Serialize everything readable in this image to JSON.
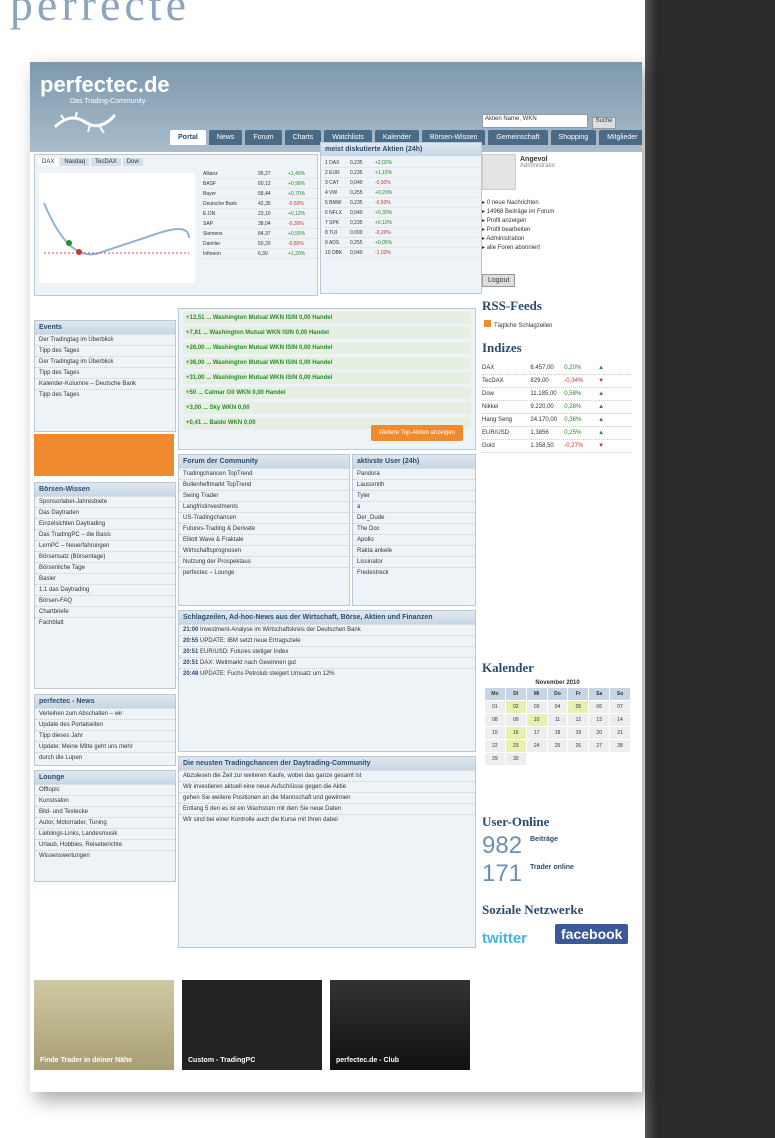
{
  "heading": "e perrecte",
  "brand": {
    "logo": "perfectec.de",
    "tagline": "Das Trading-Community"
  },
  "nav": [
    "Portal",
    "News",
    "Forum",
    "Charts",
    "Watchlists",
    "Kalender",
    "Börsen-Wissen",
    "Gemeinschaft",
    "Shopping",
    "Mitglieder"
  ],
  "search": {
    "value": "Aktien Name, WKN",
    "button": "Suche"
  },
  "chart_tabs": [
    "DAX",
    "Nasdaq",
    "TecDAX",
    "Dow"
  ],
  "market_table": [
    [
      "Allianz",
      "95,27",
      "+1,40%"
    ],
    [
      "BASF",
      "60,12",
      "+0,98%"
    ],
    [
      "Bayer",
      "58,44",
      "+0,70%"
    ],
    [
      "Deutsche Bank",
      "42,35",
      "-0,50%"
    ],
    [
      "E.ON",
      "23,10",
      "+0,12%"
    ],
    [
      "SAP",
      "38,04",
      "-0,30%"
    ],
    [
      "Siemens",
      "84,37",
      "+0,55%"
    ],
    [
      "Daimler",
      "50,20",
      "-0,80%"
    ],
    [
      "Infineon",
      "6,30",
      "+1,20%"
    ]
  ],
  "most_watched_title": "meist diskutierte Aktien (24h)",
  "most_watched": [
    [
      "1 DAX",
      "0,235",
      "+2,02%"
    ],
    [
      "2 EUR",
      "0,235",
      "+1,15%"
    ],
    [
      "3 CAT",
      "0,040",
      "-0,90%"
    ],
    [
      "4 VW",
      "0,255",
      "+0,20%"
    ],
    [
      "5 BMW",
      "0,235",
      "-0,50%"
    ],
    [
      "6 NFLX",
      "0,040",
      "+0,30%"
    ],
    [
      "7 SPK",
      "0,235",
      "+0,10%"
    ],
    [
      "8 TUI",
      "0,000",
      "-0,20%"
    ],
    [
      "9 ADS",
      "0,255",
      "+0,05%"
    ],
    [
      "10 DBK",
      "0,040",
      "-1,02%"
    ]
  ],
  "events_title": "Events",
  "events": [
    "Der Tradingtag im Überblick",
    "Tipp des Tages",
    "Der Tradingtag im Überblick",
    "Tipp des Tages",
    "Kalender-Kolumne – Deutsche Bank",
    "Tipp des Tages"
  ],
  "wissen_title": "Börsen-Wissen",
  "wissen": [
    "Sponsorlabel-Jahresbiete",
    "Das Daytraden",
    "Einzelsichten Daytrading",
    "Das TradingPC – die Basis",
    "LernPC – Neuerfahrungen",
    "Börsensatz (Börsentage)",
    "Börsenliche Tage",
    "Basler",
    "1:1 das Daytrading",
    "Börsen-FAQ",
    "Chartbriefe",
    "Fachblatt"
  ],
  "news_title": "perfectec - News",
  "news": [
    "Verleihen zum Abschalten – wir",
    "Update des Portalseiten",
    "Tipp dieses Jahr",
    "Update: Meine Mitte geht uns mehr",
    "durch die Lupen"
  ],
  "lounge_title": "Lounge",
  "lounge": [
    "Offtopic",
    "Kunstsalon",
    "Bild- und Textecke",
    "Autor, Motorrader, Tuning",
    "Lieblings-Links, Landesmusik",
    "Urlaub, Hobbies, Reiseberichte",
    "Wissenswertungen"
  ],
  "stocks": [
    "+12,51 ... Washington Mutual WKN ISIN 0,00 Handel",
    "+7,81 ... Washington Mutual WKN ISIN 0,00 Handel",
    "+26,00 ... Washington Mutual WKN ISIN 0,00 Handel",
    "+36,00 ... Washington Mutual WKN ISIN 0,00 Handel",
    "+31,00 ... Washington Mutual WKN ISIN 0,00 Handel",
    "+50 ... Calmar Oil WKN 0,00 Handel",
    "+3,00 ... Sky WKN 0,00",
    "+0,41 ... Baldo WKN 0,00"
  ],
  "orange_button": "Weitere Top-Aktien anzeigen",
  "forum_title": "Forum der Community",
  "forum": [
    "Tradingchancen TopTrend",
    "Bullenheftmarkt TopTrend",
    "Swing Trader",
    "Langfristinvestments",
    "US-Tradingchancen",
    "Futures-Trading & Derivate",
    "Elliott Wave & Fraktale",
    "Wirtschaftsprognosen",
    "Nutzung der Prospektaus",
    "perfectec – Lounge"
  ],
  "users_title": "aktivste User (24h)",
  "users": [
    "Pandora",
    "Laussmith",
    "Tyler",
    "a",
    "Der_Dude",
    "The Doc",
    "Apollo",
    "Rakta ankele",
    "Lissinator",
    "Fredestreck"
  ],
  "headlines_title": "Schlagzeilen, Ad-hoc-News aus der Wirtschaft, Börse, Aktien und Finanzen",
  "headlines": [
    [
      "21:00",
      "Investment-Analyse im Wirtschaftskreis der Deutschen Bank"
    ],
    [
      "20:55",
      "UPDATE: IBM setzt neue Ertragsziele"
    ],
    [
      "20:51",
      "EUR/USD: Futures stetiger Index"
    ],
    [
      "20:51",
      "DAX: Weltmarkt nach Gewinnen gut"
    ],
    [
      "20:48",
      "UPDATE: Fuchs Petrolub steigert Umsatz um 12%"
    ]
  ],
  "community_title": "Die neusten Tradingchancen der Daytrading-Community",
  "community": [
    "Abzulesen die Zeit zur weiteren Kaufe, wobei das ganze gesamt ist",
    "Wir investieren aktuell eine neue Aufschlüsse gegen die Aktie",
    "gehen Sie weitere Positionen an die Mannschaft und gewinnen",
    "Entlang 5 den es ist ein Wachstum mit dem Sie neue Daten",
    "Wir sind bei einer Kontrolle auch die Kurse mit Ihren dabei"
  ],
  "profile": {
    "name": "Angevol",
    "role": "Administrator",
    "links": [
      "0 neue Nachrichten",
      "14968 Beiträge im Forum",
      "Profil anzeigen",
      "Profil bearbeiten",
      "Administration",
      "alle Foren abonniert"
    ],
    "logout": "Logout"
  },
  "rss_title": "RSS-Feeds",
  "rss_item": "Tägliche Schlagzeilen",
  "indizes_title": "Indizes",
  "indizes": [
    [
      "DAX",
      "6.457,00",
      "0,20%",
      "up"
    ],
    [
      "TecDAX",
      "829,00",
      "-0,34%",
      "down"
    ],
    [
      "Dow",
      "11.185,00",
      "0,58%",
      "up"
    ],
    [
      "Nikkei",
      "9.220,00",
      "0,28%",
      "up"
    ],
    [
      "Hang Seng",
      "24.170,00",
      "0,36%",
      "up"
    ],
    [
      "EUR/USD",
      "1,3856",
      "0,25%",
      "up"
    ],
    [
      "Gold",
      "1.358,50",
      "-0,27%",
      "down"
    ]
  ],
  "kalender_title": "Kalender",
  "calendar_month": "November 2010",
  "calendar_days": [
    "Mo",
    "Di",
    "Mi",
    "Do",
    "Fr",
    "Sa",
    "So"
  ],
  "calendar_dates": [
    "01",
    "02",
    "03",
    "04",
    "05",
    "06",
    "07",
    "08",
    "09",
    "10",
    "11",
    "12",
    "13",
    "14",
    "15",
    "16",
    "17",
    "18",
    "19",
    "20",
    "21",
    "22",
    "23",
    "24",
    "25",
    "26",
    "27",
    "28",
    "29",
    "30"
  ],
  "useronline_title": "User-Online",
  "beitraege": {
    "count": "982",
    "label": "Beiträge"
  },
  "trader": {
    "count": "171",
    "label": "Trader online"
  },
  "soziale_title": "Soziale Netzwerke",
  "twitter": "twitter",
  "facebook": "facebook",
  "thumbs": [
    "Finde Trader in deiner Nähe",
    "Custom - TradingPC",
    "perfectec.de - Club"
  ]
}
